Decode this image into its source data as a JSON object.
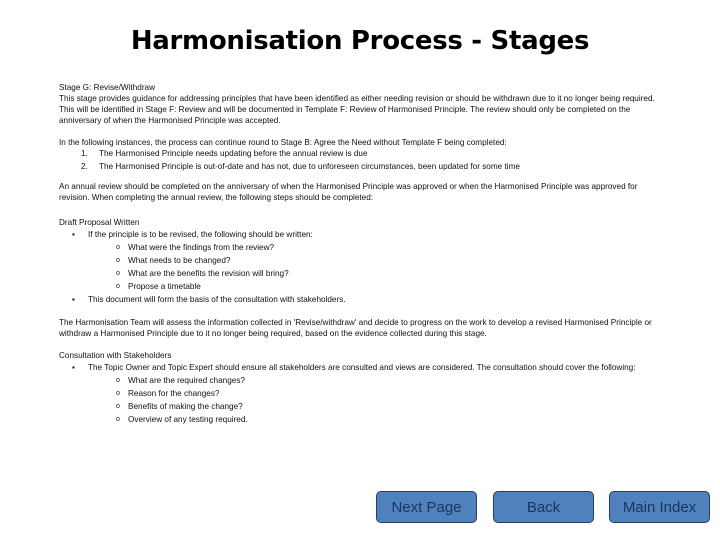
{
  "title": "Harmonisation Process - Stages",
  "section": {
    "heading": "Stage G: Revise/Withdraw",
    "intro": "This stage provides guidance for addressing principles that have been identified as either needing revision or should be withdrawn due to it no longer being required. This will be identified in Stage F: Review and will be documented in Template F: Review of Harmonised Principle. The review should only be completed on the anniversary of when the Harmonised Principle was accepted.",
    "instances_intro": "In the following instances, the process can continue round to Stage B: Agree the Need without Template F being completed:",
    "instances": [
      {
        "num": "1.",
        "text": "The Harmonised Principle needs updating before the annual review is due"
      },
      {
        "num": "2.",
        "text": "The Harmonised Principle is out-of-date and has not, due to unforeseen circumstances, been updated for some time"
      }
    ],
    "annual_review": "An annual review should be completed on the anniversary of when the Harmonised Principle was approved or when the Harmonised Principle was approved for revision. When completing the annual review, the following steps should be completed:",
    "draft": {
      "heading": "Draft Proposal Written",
      "bullet1": "If the principle is to be revised, the following should be written:",
      "sub_items": [
        "What were the findings from the review?",
        "What needs to be changed?",
        "What are the benefits the revision will bring?",
        "Propose a timetable"
      ],
      "bullet2": "This document will form the basis of the consultation with stakeholders."
    },
    "team_assess": "The Harmonisation Team will assess the information collected in 'Revise/withdraw' and decide to progress on the work to develop a revised Harmonised Principle or withdraw a Harmonised Principle due to it no longer being required, based on the evidence collected during this stage.",
    "consultation": {
      "heading": "Consultation with Stakeholders",
      "bullet1": "The Topic Owner and Topic Expert should ensure all stakeholders are consulted and views are considered. The consultation should cover the following:",
      "sub_items": [
        "What are the required changes?",
        "Reason for the changes?",
        "Benefits of making the change?",
        "Overview of any testing required."
      ]
    }
  },
  "markers": {
    "bullet": "▪",
    "sub": "o"
  },
  "buttons": {
    "next": "Next Page",
    "back": "Back",
    "main_index": "Main Index"
  },
  "colors": {
    "button_fill": "#4f81bd",
    "button_border": "#243f60",
    "button_text": "#17375e"
  }
}
